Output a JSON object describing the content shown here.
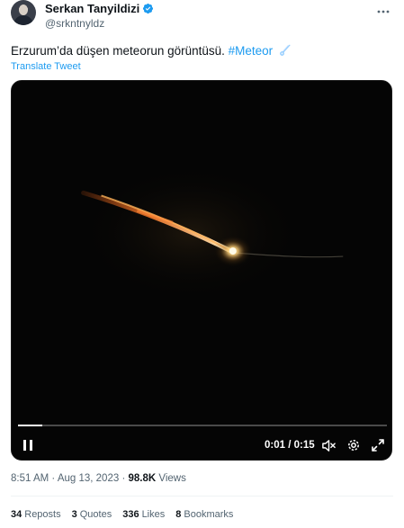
{
  "author": {
    "display_name": "Serkan Tanyildizi",
    "handle": "@srkntnyldz"
  },
  "tweet": {
    "text": "Erzurum’da düşen meteorun görüntüsü.",
    "hashtag": "#Meteor",
    "translate_label": "Translate Tweet"
  },
  "video": {
    "current_time": "0:01",
    "duration": "0:15",
    "time_separator": "/",
    "progress_fraction": 0.067
  },
  "meta": {
    "time": "8:51 AM",
    "separator": "·",
    "date": "Aug 13, 2023",
    "views_count": "98.8K",
    "views_label": "Views"
  },
  "stats": [
    {
      "count": "34",
      "label": "Reposts"
    },
    {
      "count": "3",
      "label": "Quotes"
    },
    {
      "count": "336",
      "label": "Likes"
    },
    {
      "count": "8",
      "label": "Bookmarks"
    }
  ],
  "colors": {
    "accent": "#1d9bf0",
    "text": "#0f1419",
    "secondary_text": "#536471",
    "video_background": "#050505"
  },
  "icons": [
    "verified-badge-icon",
    "more-options-icon",
    "comet-emoji-icon",
    "pause-icon",
    "mute-icon",
    "settings-icon",
    "fullscreen-icon"
  ]
}
